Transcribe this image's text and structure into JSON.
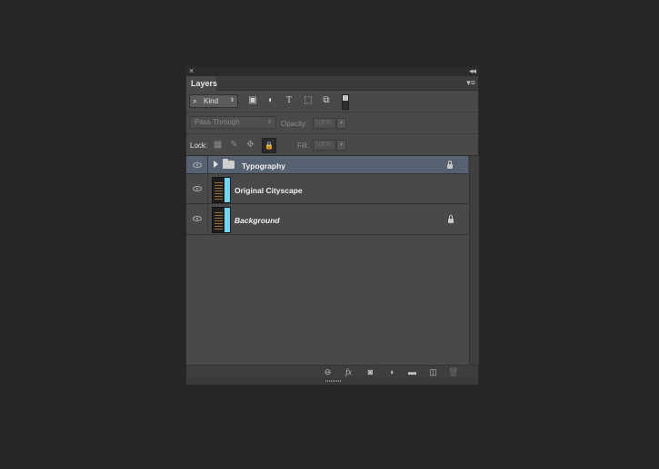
{
  "panel": {
    "close_glyph": "×",
    "collapse_glyph": "◂◂",
    "tab_label": "Layers",
    "menu_glyph": "▾≡"
  },
  "filter": {
    "kind_icon": "⌕",
    "kind_label": "Kind",
    "kind_arrow": "⇕",
    "icons": [
      {
        "name": "pixel-layer-filter-icon",
        "glyph": "▣"
      },
      {
        "name": "adjustment-layer-filter-icon",
        "glyph": "◐"
      },
      {
        "name": "type-layer-filter-icon",
        "glyph": "T"
      },
      {
        "name": "shape-layer-filter-icon",
        "glyph": "⬚"
      },
      {
        "name": "smart-object-filter-icon",
        "glyph": "⧉"
      }
    ]
  },
  "blend": {
    "mode": "Pass Through",
    "mode_arrow": "⇕",
    "opacity_label": "Opacity:",
    "opacity_value": "100%",
    "fill_label": "Fill:",
    "fill_value": "100%",
    "dropdown_arrow": "▾"
  },
  "lock": {
    "label": "Lock:",
    "icons": [
      {
        "name": "lock-transparent-pixels-icon",
        "glyph": "▦"
      },
      {
        "name": "lock-image-pixels-icon",
        "glyph": "✎"
      },
      {
        "name": "lock-position-icon",
        "glyph": "✥"
      },
      {
        "name": "lock-all-icon",
        "glyph": "🔒"
      }
    ]
  },
  "layers": [
    {
      "name": "Typography",
      "type": "group",
      "selected": true,
      "locked": true
    },
    {
      "name": "Original Cityscape",
      "type": "image",
      "selected": false,
      "locked": false
    },
    {
      "name": "Background",
      "type": "image",
      "selected": false,
      "locked": true,
      "italic": true
    }
  ],
  "bottom": {
    "icons": [
      {
        "name": "link-layers-icon",
        "glyph": "⊖"
      },
      {
        "name": "layer-effects-icon",
        "glyph": "fx"
      },
      {
        "name": "add-mask-icon",
        "glyph": "◙"
      },
      {
        "name": "new-adjustment-layer-icon",
        "glyph": "◑"
      },
      {
        "name": "new-group-icon",
        "glyph": "▬"
      },
      {
        "name": "new-layer-icon",
        "glyph": "◫"
      },
      {
        "name": "delete-layer-icon",
        "glyph": "🗑"
      }
    ]
  }
}
